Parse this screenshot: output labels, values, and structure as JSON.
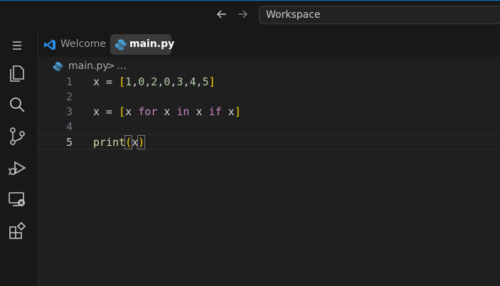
{
  "topbar": {
    "search_text": "Workspace",
    "back_icon": "arrow-left-icon",
    "forward_icon": "arrow-right-icon"
  },
  "activitybar": {
    "items": [
      {
        "name": "menu-icon"
      },
      {
        "name": "explorer-icon"
      },
      {
        "name": "search-icon"
      },
      {
        "name": "source-control-icon"
      },
      {
        "name": "run-debug-icon"
      },
      {
        "name": "remote-explorer-icon"
      },
      {
        "name": "extensions-icon"
      }
    ]
  },
  "tabs": [
    {
      "label": "Welcome",
      "icon": "vscode-logo-icon",
      "active": false
    },
    {
      "label": "main.py",
      "icon": "python-icon",
      "active": true
    }
  ],
  "breadcrumb": {
    "file": "main.py",
    "separator": ">",
    "more": "…"
  },
  "editor": {
    "line_numbers": [
      "1",
      "2",
      "3",
      "4",
      "5"
    ],
    "current_line": 5,
    "lines": [
      [
        {
          "t": "var",
          "v": "x"
        },
        {
          "t": "p",
          "v": " = "
        },
        {
          "t": "br",
          "v": "["
        },
        {
          "t": "num",
          "v": "1"
        },
        {
          "t": "p",
          "v": ","
        },
        {
          "t": "num",
          "v": "0"
        },
        {
          "t": "p",
          "v": ","
        },
        {
          "t": "num",
          "v": "2"
        },
        {
          "t": "p",
          "v": ","
        },
        {
          "t": "num",
          "v": "0"
        },
        {
          "t": "p",
          "v": ","
        },
        {
          "t": "num",
          "v": "3"
        },
        {
          "t": "p",
          "v": ","
        },
        {
          "t": "num",
          "v": "4"
        },
        {
          "t": "p",
          "v": ","
        },
        {
          "t": "num",
          "v": "5"
        },
        {
          "t": "br",
          "v": "]"
        }
      ],
      [],
      [
        {
          "t": "var",
          "v": "x"
        },
        {
          "t": "p",
          "v": " = "
        },
        {
          "t": "br",
          "v": "["
        },
        {
          "t": "var",
          "v": "x"
        },
        {
          "t": "p",
          "v": " "
        },
        {
          "t": "kw",
          "v": "for"
        },
        {
          "t": "p",
          "v": " "
        },
        {
          "t": "var",
          "v": "x"
        },
        {
          "t": "p",
          "v": " "
        },
        {
          "t": "kw",
          "v": "in"
        },
        {
          "t": "p",
          "v": " "
        },
        {
          "t": "var",
          "v": "x"
        },
        {
          "t": "p",
          "v": " "
        },
        {
          "t": "kw",
          "v": "if"
        },
        {
          "t": "p",
          "v": " "
        },
        {
          "t": "var",
          "v": "x"
        },
        {
          "t": "br",
          "v": "]"
        }
      ],
      [],
      [
        {
          "t": "fn",
          "v": "print"
        },
        {
          "t": "br",
          "v": "(",
          "box": true
        },
        {
          "t": "var",
          "v": "x"
        },
        {
          "t": "br",
          "v": ")",
          "box": true
        }
      ]
    ]
  },
  "colors": {
    "accent": "#0078d4",
    "keyword": "#c586c0",
    "bracket": "#ffd700",
    "number": "#b5cea8",
    "function": "#dcdcaa"
  }
}
